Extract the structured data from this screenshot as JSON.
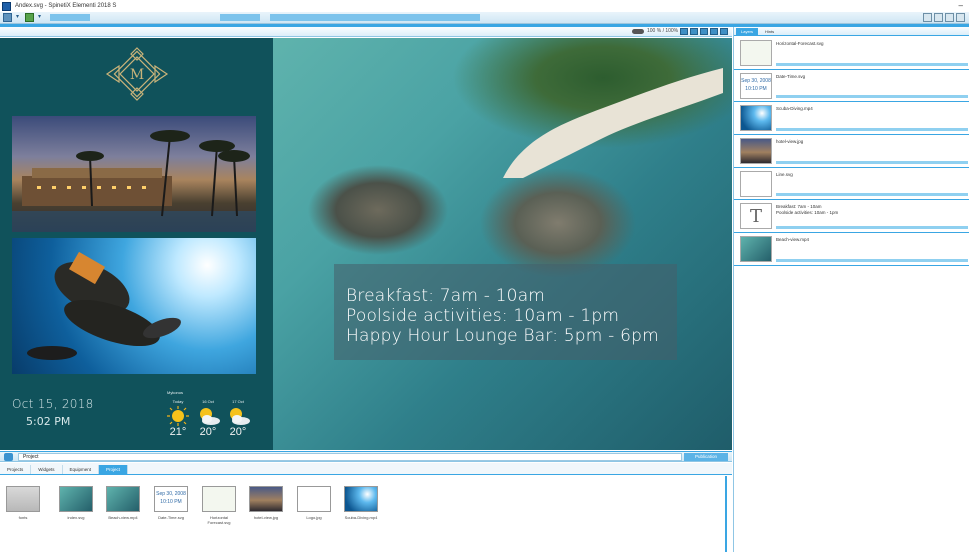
{
  "window": {
    "title": "Andex.svg - SpinetiX Elementi 2018 S",
    "minimize_label": "–"
  },
  "canvas_header": {
    "zoom": "100 % / 100%"
  },
  "layout": {
    "logo_letter": "M",
    "date": "Oct 15, 2018",
    "time": "5:02 PM",
    "weather": {
      "title": "Mykonos",
      "days": [
        {
          "label": "Today",
          "temp": "21°",
          "icon": "sun-icon"
        },
        {
          "label": "16 Oct",
          "temp": "20°",
          "icon": "sun-cloud-icon"
        },
        {
          "label": "17 Oct",
          "temp": "20°",
          "icon": "sun-cloud-icon"
        }
      ]
    },
    "info_lines": [
      "Breakfast: 7am - 10am",
      "Poolside activities: 10am - 1pm",
      "Happy Hour Lounge Bar: 5pm - 6pm"
    ]
  },
  "layers_panel": {
    "tabs": [
      "Layers",
      "Hints"
    ],
    "items": [
      {
        "name": "Horizontal-Forecast.svg",
        "thumb": "weather"
      },
      {
        "name": "Date-Time.svg",
        "thumb": "date",
        "thumb_text": "Sep 30, 2008\n10:10 PM"
      },
      {
        "name": "Scuba-Diving.mp4",
        "thumb": "dive"
      },
      {
        "name": "hotel-view.jpg",
        "thumb": "hotel"
      },
      {
        "name": "Line.svg",
        "thumb": "sig"
      },
      {
        "name": "Breakfast: 7am - 10am\nPoolside activities: 10am - 1pm",
        "thumb": "T",
        "thumb_text": "T"
      },
      {
        "name": "Beach-view.mp4",
        "thumb": "beach"
      }
    ]
  },
  "project_bar": {
    "path": "Project",
    "publish_label": "Publication"
  },
  "lower_tabs": [
    "Projects",
    "Widgets",
    "Equipment",
    "Project"
  ],
  "files": [
    {
      "label": "fonts",
      "thumb": "folder"
    },
    {
      "label": "index.svg",
      "thumb": "beach"
    },
    {
      "label": "Beach-view.mp4",
      "thumb": "beach"
    },
    {
      "label": "Date-Time.svg",
      "thumb": "date",
      "thumb_text": "Sep 30, 2008\n10:10 PM"
    },
    {
      "label": "Horizontal\nForecast.svg",
      "thumb": "weather"
    },
    {
      "label": "hotel-view.jpg",
      "thumb": "hotel"
    },
    {
      "label": "Logo.jpg",
      "thumb": "sig"
    },
    {
      "label": "Scuba-Diving.mp4",
      "thumb": "dive"
    }
  ]
}
